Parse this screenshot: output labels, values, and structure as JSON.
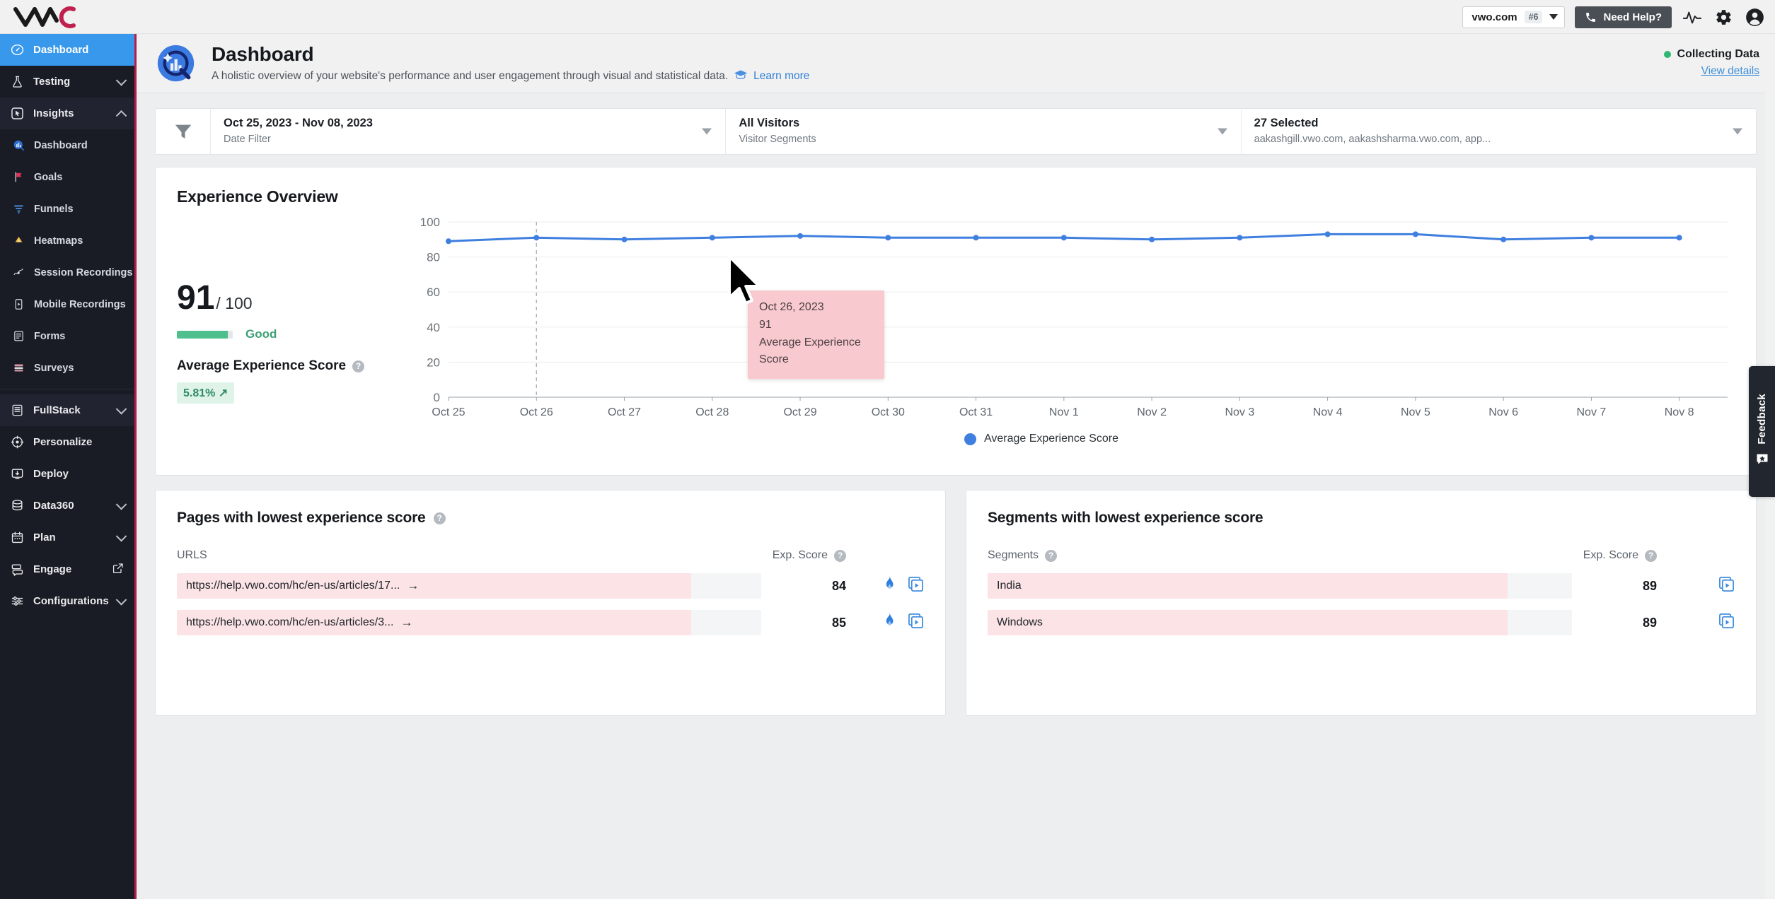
{
  "topbar": {
    "logo_text": "VWO",
    "site_name": "vwo.com",
    "site_badge": "#6",
    "help_label": "Need Help?",
    "icons": [
      "pulse-icon",
      "gear-icon",
      "user-avatar-icon"
    ]
  },
  "sidebar": {
    "items": [
      {
        "label": "Dashboard",
        "icon": "speedometer-icon",
        "state": "active",
        "level": "top"
      },
      {
        "label": "Testing",
        "icon": "flask-icon",
        "state": "collapsed",
        "level": "top"
      },
      {
        "label": "Insights",
        "icon": "cursor-box-icon",
        "state": "expanded",
        "level": "group"
      },
      {
        "label": "Dashboard",
        "icon": "bar-chart-icon",
        "level": "sub"
      },
      {
        "label": "Goals",
        "icon": "flag-icon",
        "level": "sub"
      },
      {
        "label": "Funnels",
        "icon": "funnel-icon",
        "level": "sub"
      },
      {
        "label": "Heatmaps",
        "icon": "heatmap-icon",
        "level": "sub"
      },
      {
        "label": "Session Recordings",
        "icon": "recording-icon",
        "level": "sub"
      },
      {
        "label": "Mobile Recordings",
        "icon": "mobile-play-icon",
        "level": "sub"
      },
      {
        "label": "Forms",
        "icon": "form-icon",
        "level": "sub"
      },
      {
        "label": "Surveys",
        "icon": "survey-icon",
        "level": "sub"
      },
      {
        "label": "FullStack",
        "icon": "server-icon",
        "state": "collapsed",
        "level": "top"
      },
      {
        "label": "Personalize",
        "icon": "target-icon",
        "level": "top"
      },
      {
        "label": "Deploy",
        "icon": "deploy-icon",
        "level": "top"
      },
      {
        "label": "Data360",
        "icon": "database-icon",
        "state": "collapsed",
        "level": "top"
      },
      {
        "label": "Plan",
        "icon": "calendar-icon",
        "state": "collapsed",
        "level": "top"
      },
      {
        "label": "Engage",
        "icon": "chat-stack-icon",
        "state": "external",
        "level": "top"
      },
      {
        "label": "Configurations",
        "icon": "sliders-icon",
        "state": "collapsed",
        "level": "top"
      }
    ]
  },
  "header": {
    "title": "Dashboard",
    "subtitle": "A holistic overview of your website's performance and user engagement through visual and statistical data.",
    "learn_more": "Learn more",
    "status_label": "Collecting Data",
    "status_color": "#2eb872",
    "view_details": "View details"
  },
  "filters": {
    "icon": "filter-icon",
    "date": {
      "value": "Oct 25, 2023 - Nov 08, 2023",
      "label": "Date Filter"
    },
    "segment": {
      "value": "All Visitors",
      "label": "Visitor Segments"
    },
    "sites": {
      "value": "27 Selected",
      "label": "aakashgill.vwo.com, aakashsharma.vwo.com, app..."
    }
  },
  "overview": {
    "title": "Experience Overview",
    "score": "91",
    "score_denominator": "/ 100",
    "meter_percent": 91,
    "meter_label": "Good",
    "meter_color": "#4fc08d",
    "metric_label": "Average Experience Score",
    "delta": "5.81% ↗",
    "delta_color": "#2f8c63"
  },
  "tooltip": {
    "date": "Oct 26, 2023",
    "value": "91",
    "series": "Average Experience Score",
    "background": "#f8c9ce"
  },
  "chart_data": {
    "type": "line",
    "title": "Experience Overview",
    "xlabel": "",
    "ylabel": "",
    "ylim": [
      0,
      100
    ],
    "yticks": [
      0,
      20,
      40,
      60,
      80,
      100
    ],
    "grid": true,
    "legend_position": "bottom",
    "legend": [
      "Average Experience Score"
    ],
    "series_color": "#3f7fe0",
    "categories": [
      "Oct 25",
      "Oct 26",
      "Oct 27",
      "Oct 28",
      "Oct 29",
      "Oct 30",
      "Oct 31",
      "Nov 1",
      "Nov 2",
      "Nov 3",
      "Nov 4",
      "Nov 5",
      "Nov 6",
      "Nov 7",
      "Nov 8"
    ],
    "series": [
      {
        "name": "Average Experience Score",
        "values": [
          89,
          91,
          90,
          91,
          92,
          91,
          91,
          91,
          90,
          91,
          93,
          93,
          90,
          91,
          91
        ]
      }
    ]
  },
  "pages_panel": {
    "title": "Pages with lowest experience score",
    "title_help": "help-icon",
    "col_url": "URLS",
    "col_score": "Exp. Score",
    "col_score_help": "help-icon",
    "rows": [
      {
        "url": "https://help.vwo.com/hc/en-us/articles/17...",
        "score": "84",
        "bar_percent": 88,
        "icons": [
          "heatmap-flame-icon",
          "recording-play-icon"
        ]
      },
      {
        "url": "https://help.vwo.com/hc/en-us/articles/3...",
        "score": "85",
        "bar_percent": 88,
        "icons": [
          "heatmap-flame-icon",
          "recording-play-icon"
        ]
      }
    ]
  },
  "segments_panel": {
    "title": "Segments with lowest experience score",
    "col_segment": "Segments",
    "col_segment_help": "help-icon",
    "col_score": "Exp. Score",
    "col_score_help": "help-icon",
    "rows": [
      {
        "segment": "India",
        "score": "89",
        "bar_percent": 89,
        "icons": [
          "recording-play-icon"
        ]
      },
      {
        "segment": "Windows",
        "score": "89",
        "bar_percent": 89,
        "icons": [
          "recording-play-icon"
        ]
      }
    ]
  },
  "feedback": {
    "label": "Feedback",
    "icon": "chat-star-icon"
  }
}
